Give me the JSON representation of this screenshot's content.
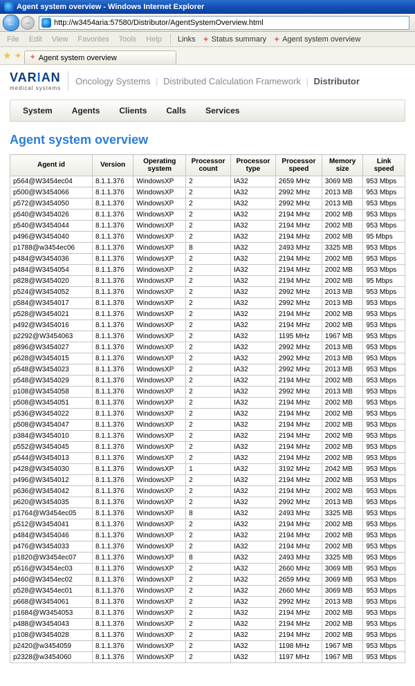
{
  "window_title": "Agent system overview - Windows Internet Explorer",
  "address": "http://w3454aria:57580/Distributor/AgentSystemOverview.html",
  "menu": {
    "file": "File",
    "edit": "Edit",
    "view": "View",
    "favorites": "Favorites",
    "tools": "Tools",
    "help": "Help"
  },
  "quicklinks": {
    "links_label": "Links",
    "status_summary": "Status summary",
    "agent_overview": "Agent system overview"
  },
  "tab_label": "Agent system overview",
  "logo": {
    "main": "VARIAN",
    "sub": "medical systems"
  },
  "breadcrumb": {
    "oncology": "Oncology Systems",
    "dcf": "Distributed Calculation Framework",
    "distributor": "Distributor"
  },
  "main_nav": {
    "system": "System",
    "agents": "Agents",
    "clients": "Clients",
    "calls": "Calls",
    "services": "Services"
  },
  "page_title": "Agent system overview",
  "table": {
    "headers": {
      "agent_id": "Agent id",
      "version": "Version",
      "os": "Operating system",
      "proc_count": "Processor count",
      "proc_type": "Processor type",
      "proc_speed": "Processor speed",
      "mem": "Memory size",
      "link": "Link speed"
    },
    "rows": [
      {
        "id": "p564@W3454ec04",
        "ver": "8.1.1.376",
        "os": "WindowsXP",
        "pc": "2",
        "pt": "IA32",
        "ps": "2659 MHz",
        "mem": "3069 MB",
        "ls": "953 Mbps"
      },
      {
        "id": "p500@W3454066",
        "ver": "8.1.1.376",
        "os": "WindowsXP",
        "pc": "2",
        "pt": "IA32",
        "ps": "2992 MHz",
        "mem": "2013 MB",
        "ls": "953 Mbps"
      },
      {
        "id": "p572@W3454050",
        "ver": "8.1.1.376",
        "os": "WindowsXP",
        "pc": "2",
        "pt": "IA32",
        "ps": "2992 MHz",
        "mem": "2013 MB",
        "ls": "953 Mbps"
      },
      {
        "id": "p540@W3454026",
        "ver": "8.1.1.376",
        "os": "WindowsXP",
        "pc": "2",
        "pt": "IA32",
        "ps": "2194 MHz",
        "mem": "2002 MB",
        "ls": "953 Mbps"
      },
      {
        "id": "p540@W3454044",
        "ver": "8.1.1.376",
        "os": "WindowsXP",
        "pc": "2",
        "pt": "IA32",
        "ps": "2194 MHz",
        "mem": "2002 MB",
        "ls": "953 Mbps"
      },
      {
        "id": "p496@W3454040",
        "ver": "8.1.1.376",
        "os": "WindowsXP",
        "pc": "2",
        "pt": "IA32",
        "ps": "2194 MHz",
        "mem": "2002 MB",
        "ls": "95 Mbps"
      },
      {
        "id": "p1788@w3454ec06",
        "ver": "8.1.1.376",
        "os": "WindowsXP",
        "pc": "8",
        "pt": "IA32",
        "ps": "2493 MHz",
        "mem": "3325 MB",
        "ls": "953 Mbps"
      },
      {
        "id": "p484@W3454036",
        "ver": "8.1.1.376",
        "os": "WindowsXP",
        "pc": "2",
        "pt": "IA32",
        "ps": "2194 MHz",
        "mem": "2002 MB",
        "ls": "953 Mbps"
      },
      {
        "id": "p484@W3454054",
        "ver": "8.1.1.376",
        "os": "WindowsXP",
        "pc": "2",
        "pt": "IA32",
        "ps": "2194 MHz",
        "mem": "2002 MB",
        "ls": "953 Mbps"
      },
      {
        "id": "p828@W3454020",
        "ver": "8.1.1.376",
        "os": "WindowsXP",
        "pc": "2",
        "pt": "IA32",
        "ps": "2194 MHz",
        "mem": "2002 MB",
        "ls": "95 Mbps"
      },
      {
        "id": "p524@W3454052",
        "ver": "8.1.1.376",
        "os": "WindowsXP",
        "pc": "2",
        "pt": "IA32",
        "ps": "2992 MHz",
        "mem": "2013 MB",
        "ls": "953 Mbps"
      },
      {
        "id": "p584@W3454017",
        "ver": "8.1.1.376",
        "os": "WindowsXP",
        "pc": "2",
        "pt": "IA32",
        "ps": "2992 MHz",
        "mem": "2013 MB",
        "ls": "953 Mbps"
      },
      {
        "id": "p528@W3454021",
        "ver": "8.1.1.376",
        "os": "WindowsXP",
        "pc": "2",
        "pt": "IA32",
        "ps": "2194 MHz",
        "mem": "2002 MB",
        "ls": "953 Mbps"
      },
      {
        "id": "p492@W3454016",
        "ver": "8.1.1.376",
        "os": "WindowsXP",
        "pc": "2",
        "pt": "IA32",
        "ps": "2194 MHz",
        "mem": "2002 MB",
        "ls": "953 Mbps"
      },
      {
        "id": "p2292@W3454063",
        "ver": "8.1.1.376",
        "os": "WindowsXP",
        "pc": "2",
        "pt": "IA32",
        "ps": "1195 MHz",
        "mem": "1967 MB",
        "ls": "953 Mbps"
      },
      {
        "id": "p896@W3454027",
        "ver": "8.1.1.376",
        "os": "WindowsXP",
        "pc": "2",
        "pt": "IA32",
        "ps": "2992 MHz",
        "mem": "2013 MB",
        "ls": "953 Mbps"
      },
      {
        "id": "p628@W3454015",
        "ver": "8.1.1.376",
        "os": "WindowsXP",
        "pc": "2",
        "pt": "IA32",
        "ps": "2992 MHz",
        "mem": "2013 MB",
        "ls": "953 Mbps"
      },
      {
        "id": "p548@W3454023",
        "ver": "8.1.1.376",
        "os": "WindowsXP",
        "pc": "2",
        "pt": "IA32",
        "ps": "2992 MHz",
        "mem": "2013 MB",
        "ls": "953 Mbps"
      },
      {
        "id": "p548@W3454029",
        "ver": "8.1.1.376",
        "os": "WindowsXP",
        "pc": "2",
        "pt": "IA32",
        "ps": "2194 MHz",
        "mem": "2002 MB",
        "ls": "953 Mbps"
      },
      {
        "id": "p108@W3454058",
        "ver": "8.1.1.376",
        "os": "WindowsXP",
        "pc": "2",
        "pt": "IA32",
        "ps": "2992 MHz",
        "mem": "2013 MB",
        "ls": "953 Mbps"
      },
      {
        "id": "p508@W3454051",
        "ver": "8.1.1.376",
        "os": "WindowsXP",
        "pc": "2",
        "pt": "IA32",
        "ps": "2194 MHz",
        "mem": "2002 MB",
        "ls": "953 Mbps"
      },
      {
        "id": "p536@W3454022",
        "ver": "8.1.1.376",
        "os": "WindowsXP",
        "pc": "2",
        "pt": "IA32",
        "ps": "2194 MHz",
        "mem": "2002 MB",
        "ls": "953 Mbps"
      },
      {
        "id": "p508@W3454047",
        "ver": "8.1.1.376",
        "os": "WindowsXP",
        "pc": "2",
        "pt": "IA32",
        "ps": "2194 MHz",
        "mem": "2002 MB",
        "ls": "953 Mbps"
      },
      {
        "id": "p384@W3454010",
        "ver": "8.1.1.376",
        "os": "WindowsXP",
        "pc": "2",
        "pt": "IA32",
        "ps": "2194 MHz",
        "mem": "2002 MB",
        "ls": "953 Mbps"
      },
      {
        "id": "p552@W3454045",
        "ver": "8.1.1.376",
        "os": "WindowsXP",
        "pc": "2",
        "pt": "IA32",
        "ps": "2194 MHz",
        "mem": "2002 MB",
        "ls": "953 Mbps"
      },
      {
        "id": "p544@W3454013",
        "ver": "8.1.1.376",
        "os": "WindowsXP",
        "pc": "2",
        "pt": "IA32",
        "ps": "2194 MHz",
        "mem": "2002 MB",
        "ls": "953 Mbps"
      },
      {
        "id": "p428@W3454030",
        "ver": "8.1.1.376",
        "os": "WindowsXP",
        "pc": "1",
        "pt": "IA32",
        "ps": "3192 MHz",
        "mem": "2042 MB",
        "ls": "953 Mbps"
      },
      {
        "id": "p496@W3454012",
        "ver": "8.1.1.376",
        "os": "WindowsXP",
        "pc": "2",
        "pt": "IA32",
        "ps": "2194 MHz",
        "mem": "2002 MB",
        "ls": "953 Mbps"
      },
      {
        "id": "p636@W3454042",
        "ver": "8.1.1.376",
        "os": "WindowsXP",
        "pc": "2",
        "pt": "IA32",
        "ps": "2194 MHz",
        "mem": "2002 MB",
        "ls": "953 Mbps"
      },
      {
        "id": "p620@W3454035",
        "ver": "8.1.1.376",
        "os": "WindowsXP",
        "pc": "2",
        "pt": "IA32",
        "ps": "2992 MHz",
        "mem": "2013 MB",
        "ls": "953 Mbps"
      },
      {
        "id": "p1764@W3454ec05",
        "ver": "8.1.1.376",
        "os": "WindowsXP",
        "pc": "8",
        "pt": "IA32",
        "ps": "2493 MHz",
        "mem": "3325 MB",
        "ls": "953 Mbps"
      },
      {
        "id": "p512@W3454041",
        "ver": "8.1.1.376",
        "os": "WindowsXP",
        "pc": "2",
        "pt": "IA32",
        "ps": "2194 MHz",
        "mem": "2002 MB",
        "ls": "953 Mbps"
      },
      {
        "id": "p484@W3454046",
        "ver": "8.1.1.376",
        "os": "WindowsXP",
        "pc": "2",
        "pt": "IA32",
        "ps": "2194 MHz",
        "mem": "2002 MB",
        "ls": "953 Mbps"
      },
      {
        "id": "p476@W3454033",
        "ver": "8.1.1.376",
        "os": "WindowsXP",
        "pc": "2",
        "pt": "IA32",
        "ps": "2194 MHz",
        "mem": "2002 MB",
        "ls": "953 Mbps"
      },
      {
        "id": "p1820@W3454ec07",
        "ver": "8.1.1.376",
        "os": "WindowsXP",
        "pc": "8",
        "pt": "IA32",
        "ps": "2493 MHz",
        "mem": "3325 MB",
        "ls": "953 Mbps"
      },
      {
        "id": "p516@W3454ec03",
        "ver": "8.1.1.376",
        "os": "WindowsXP",
        "pc": "2",
        "pt": "IA32",
        "ps": "2660 MHz",
        "mem": "3069 MB",
        "ls": "953 Mbps"
      },
      {
        "id": "p460@W3454ec02",
        "ver": "8.1.1.376",
        "os": "WindowsXP",
        "pc": "2",
        "pt": "IA32",
        "ps": "2659 MHz",
        "mem": "3069 MB",
        "ls": "953 Mbps"
      },
      {
        "id": "p528@W3454ec01",
        "ver": "8.1.1.376",
        "os": "WindowsXP",
        "pc": "2",
        "pt": "IA32",
        "ps": "2660 MHz",
        "mem": "3069 MB",
        "ls": "953 Mbps"
      },
      {
        "id": "p668@W3454061",
        "ver": "8.1.1.376",
        "os": "WindowsXP",
        "pc": "2",
        "pt": "IA32",
        "ps": "2992 MHz",
        "mem": "2013 MB",
        "ls": "953 Mbps"
      },
      {
        "id": "p1684@W3454053",
        "ver": "8.1.1.376",
        "os": "WindowsXP",
        "pc": "2",
        "pt": "IA32",
        "ps": "2194 MHz",
        "mem": "2002 MB",
        "ls": "953 Mbps"
      },
      {
        "id": "p488@W3454043",
        "ver": "8.1.1.376",
        "os": "WindowsXP",
        "pc": "2",
        "pt": "IA32",
        "ps": "2194 MHz",
        "mem": "2002 MB",
        "ls": "953 Mbps"
      },
      {
        "id": "p108@W3454028",
        "ver": "8.1.1.376",
        "os": "WindowsXP",
        "pc": "2",
        "pt": "IA32",
        "ps": "2194 MHz",
        "mem": "2002 MB",
        "ls": "953 Mbps"
      },
      {
        "id": "p2420@w3454059",
        "ver": "8.1.1.376",
        "os": "WindowsXP",
        "pc": "2",
        "pt": "IA32",
        "ps": "1198 MHz",
        "mem": "1967 MB",
        "ls": "953 Mbps"
      },
      {
        "id": "p2328@w3454060",
        "ver": "8.1.1.376",
        "os": "WindowsXP",
        "pc": "2",
        "pt": "IA32",
        "ps": "1197 MHz",
        "mem": "1967 MB",
        "ls": "953 Mbps"
      }
    ]
  }
}
